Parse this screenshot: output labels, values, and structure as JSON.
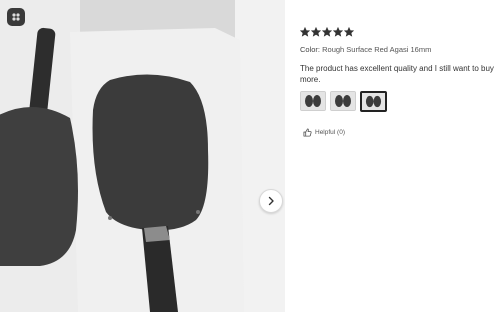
{
  "review": {
    "rating": 5,
    "max_rating": 5,
    "color_label": "Color:",
    "color_value": "Rough Surface Red Agasi 16mm",
    "text": "The product has excellent quality and I still want to buy more.",
    "thumbnails": [
      {
        "name": "photo-1",
        "selected": false
      },
      {
        "name": "photo-2",
        "selected": false
      },
      {
        "name": "photo-3",
        "selected": true
      }
    ],
    "helpful_label": "Helpful (0)"
  },
  "icons": {
    "star": "star-icon",
    "next": "chevron-right-icon",
    "helpful": "thumbs-up-icon",
    "corner": "brand-logo-icon"
  },
  "colors": {
    "star": "#333333",
    "selected_border": "#222222"
  }
}
